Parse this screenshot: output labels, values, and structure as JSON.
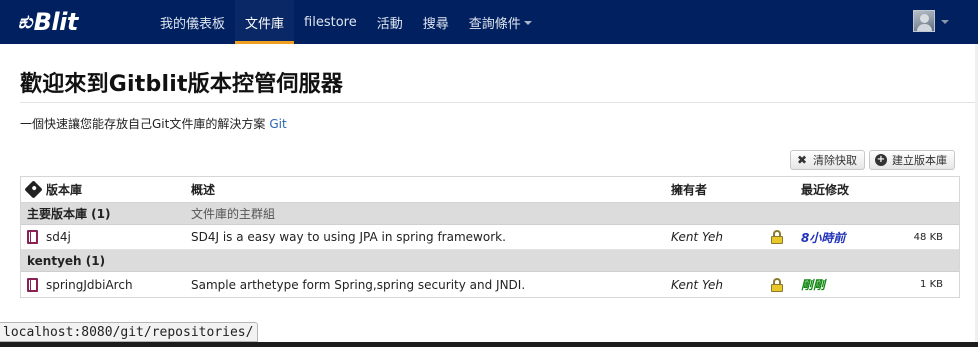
{
  "app": {
    "brand_mark": "ಕು",
    "brand_text": "Blit"
  },
  "nav": {
    "items": [
      {
        "label": "我的儀表板",
        "active": false
      },
      {
        "label": "文件庫",
        "active": true
      },
      {
        "label": "filestore",
        "active": false
      },
      {
        "label": "活動",
        "active": false
      },
      {
        "label": "搜尋",
        "active": false
      },
      {
        "label": "查詢條件",
        "active": false,
        "dropdown": true
      }
    ],
    "user_icon": "avatar-icon"
  },
  "page": {
    "title": "歡迎來到Gitblit版本控管伺服器",
    "intro": "一個快速讓您能存放自己Git文件庫的解決方案",
    "intro_link": "Git"
  },
  "toolbar": {
    "clear_cache_label": "清除快取",
    "new_repo_label": "建立版本庫"
  },
  "table": {
    "headers": {
      "name": "版本庫",
      "description": "概述",
      "owner": "擁有者",
      "last_change": "最近修改"
    },
    "groups": [
      {
        "name": "主要版本庫 (1)",
        "description": "文件庫的主群組",
        "repos": [
          {
            "name": "sd4j",
            "description": "SD4J is a easy way to using JPA in spring framework.",
            "owner": "Kent Yeh",
            "last_change": "8小時前",
            "last_change_color": "#2233bb",
            "size": "48 KB"
          }
        ]
      },
      {
        "name": "kentyeh (1)",
        "description": "",
        "repos": [
          {
            "name": "springJdbiArch",
            "description": "Sample arthetype form Spring,spring security and JNDI.",
            "owner": "Kent Yeh",
            "last_change": "剛剛",
            "last_change_color": "#118811",
            "size": "1 KB"
          }
        ]
      }
    ]
  },
  "status_bar": {
    "url": "localhost:8080/git/repositories/"
  },
  "colors": {
    "navbar": "#002060",
    "active_tab_indicator": "#f0a020",
    "link": "#2a64b0"
  }
}
